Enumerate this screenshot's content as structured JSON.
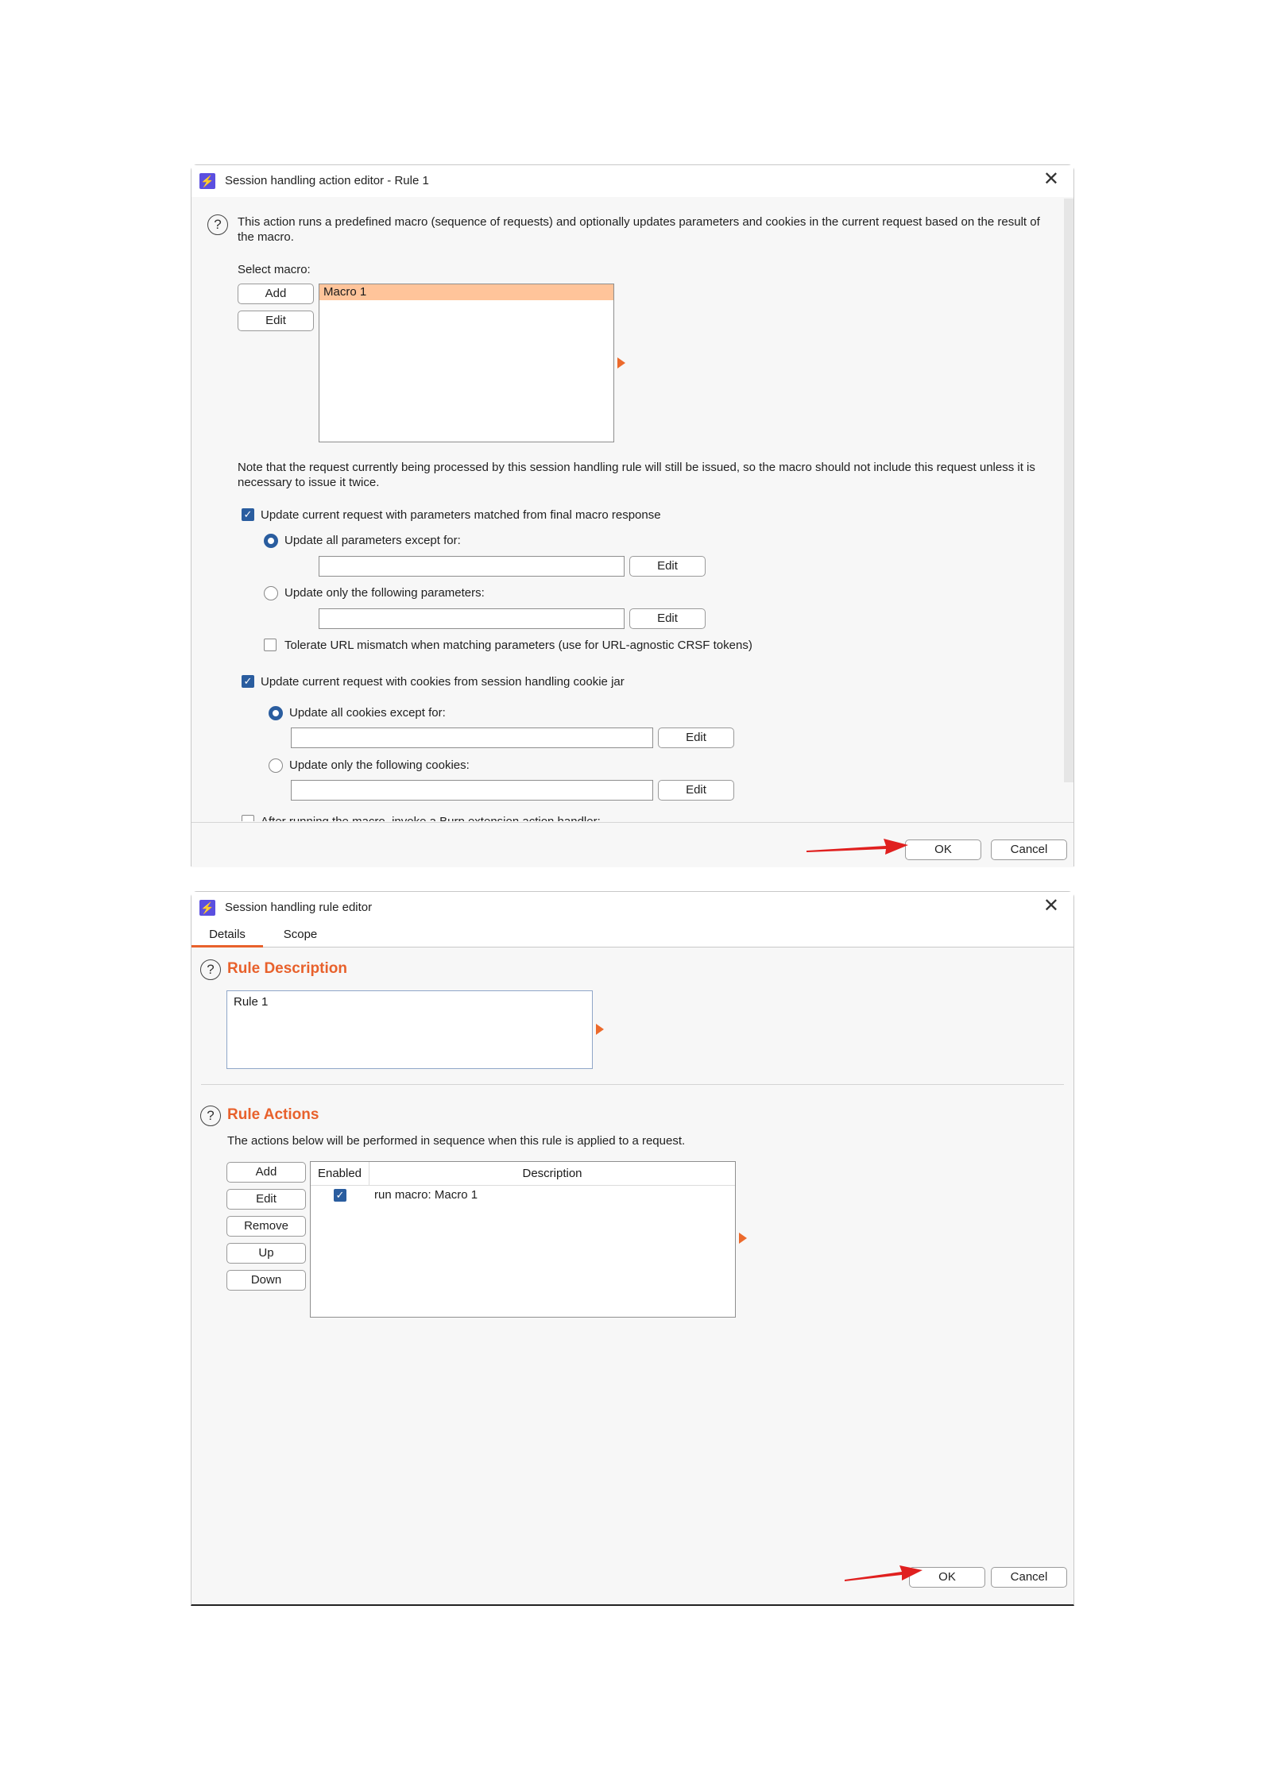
{
  "action_editor": {
    "title": "Session handling action editor - Rule 1",
    "intro": "This action runs a predefined macro (sequence of requests) and optionally updates parameters and cookies in the current request based on the result of the macro.",
    "select_macro_label": "Select macro:",
    "add_label": "Add",
    "edit_label": "Edit",
    "macros": [
      "Macro 1"
    ],
    "note": "Note that the request currently being processed by this session handling rule will still be issued, so the macro should not include this request unless it is necessary to issue it twice.",
    "params_checkbox": "Update current request with parameters matched from final macro response",
    "params_all_radio": "Update all parameters except for:",
    "params_only_radio": "Update only the following parameters:",
    "tolerate_checkbox": "Tolerate URL mismatch when matching parameters (use for URL-agnostic CRSF tokens)",
    "cookies_checkbox": "Update current request with cookies from session handling cookie jar",
    "cookies_all_radio": "Update all cookies except for:",
    "cookies_only_radio": "Update only the following cookies:",
    "extension_checkbox": "After running the macro, invoke a Burp extension action handler:",
    "ok_label": "OK",
    "cancel_label": "Cancel"
  },
  "rule_editor": {
    "title": "Session handling rule editor",
    "tabs": [
      "Details",
      "Scope"
    ],
    "rule_description_heading": "Rule Description",
    "rule_description_value": "Rule 1",
    "rule_actions_heading": "Rule Actions",
    "rule_actions_text": "The actions below will be performed in sequence when this rule is applied to a request.",
    "buttons": [
      "Add",
      "Edit",
      "Remove",
      "Up",
      "Down"
    ],
    "table_headers": [
      "Enabled",
      "Description"
    ],
    "rows": [
      {
        "enabled": true,
        "description": "run macro: Macro 1"
      }
    ],
    "ok_label": "OK",
    "cancel_label": "Cancel"
  },
  "colors": {
    "accent_orange": "#e8612c",
    "selection": "#ffc49a",
    "checkbox_blue": "#2a5d9f",
    "app_icon": "#5b4fe0",
    "annotation_arrow": "#e0201f"
  }
}
